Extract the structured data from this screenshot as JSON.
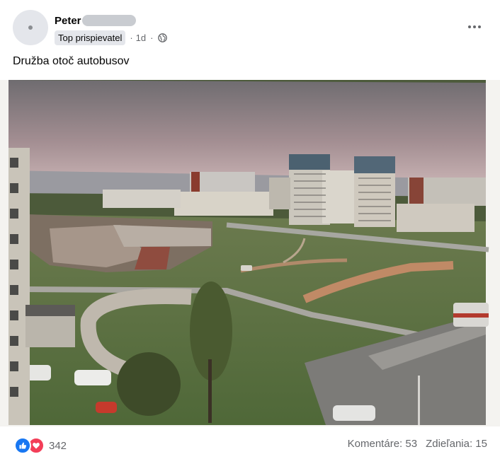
{
  "post": {
    "author_name": "Peter",
    "badge": "Top prispievatel",
    "time": "1d",
    "separator": "·",
    "caption": "Družba otoč autobusov"
  },
  "icons": {
    "privacy": "globe-icon",
    "menu": "more-horizontal-icon",
    "like": "like-icon",
    "love": "love-icon"
  },
  "footer": {
    "reaction_count": "342",
    "comments": "Komentáre: 53",
    "shares": "Zdieľania: 15"
  },
  "colors": {
    "like": "#1877f2",
    "love": "#f33e58",
    "secondary_text": "#65676b"
  }
}
